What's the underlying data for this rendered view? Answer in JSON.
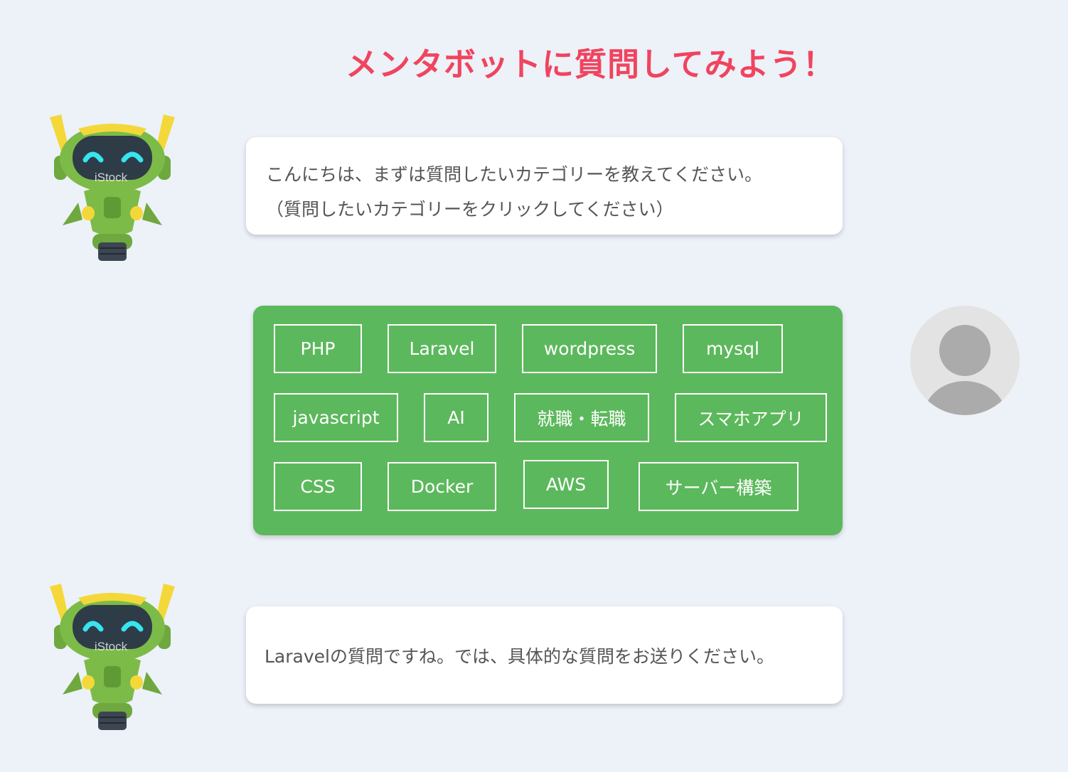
{
  "title": "メンタボットに質問してみよう！",
  "bot": {
    "watermark": "iStock",
    "greeting_line1": "こんにちは、まずは質問したいカテゴリーを教えてください。",
    "greeting_line2": "（質問したいカテゴリーをクリックしてください）",
    "reply": "Laravelの質問ですね。では、具体的な質問をお送りください。"
  },
  "categories": [
    "PHP",
    "Laravel",
    "wordpress",
    "mysql",
    "javascript",
    "AI",
    "就職・転職",
    "スマホアプリ",
    "CSS",
    "Docker",
    "AWS",
    "サーバー構築"
  ],
  "colors": {
    "background": "#edf1f8",
    "title": "#f0445f",
    "category_panel": "#5cb85c",
    "bubble": "#ffffff",
    "bubble_text": "#555555",
    "avatar_bg": "#e3e3e3",
    "avatar_fg": "#ababab"
  },
  "icons": {
    "bot_avatar": "robot-icon",
    "user_avatar": "user-silhouette-icon"
  }
}
